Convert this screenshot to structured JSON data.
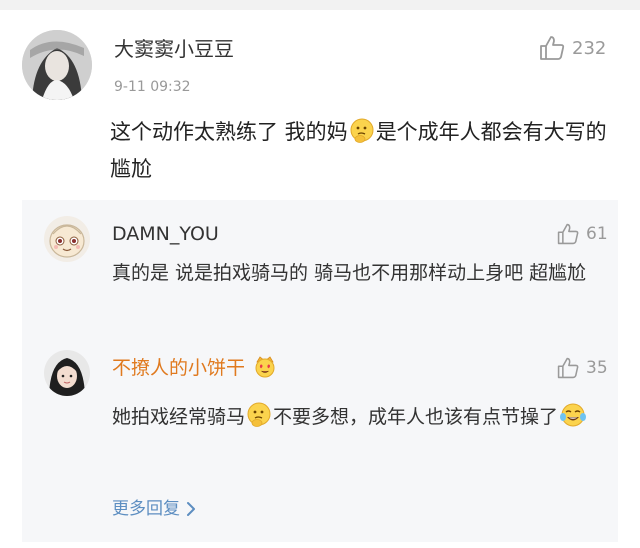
{
  "colors": {
    "username": "#333333",
    "reply_username_blue": "#333333",
    "reply_username_orange": "#e07a1f",
    "link": "#5d8ec1",
    "muted": "#999999",
    "panel_bg": "#f6f7f9"
  },
  "main_comment": {
    "username": "大窦窦小豆豆",
    "time": "9-11 09:32",
    "likes": "232",
    "text_part1": "这个动作太熟练了 我的妈",
    "text_part2": "是个成年人都会有大写的尴尬",
    "emoji": "thinking-face-icon"
  },
  "replies": [
    {
      "username": "DAMN_YOU",
      "likes": "61",
      "text": "真的是 说是拍戏骑马的 骑马也不用那样动上身吧 超尴尬",
      "avatar": "cartoon-baby-icon"
    },
    {
      "username": "不撩人的小饼干",
      "likes": "35",
      "badge": "heart-eyes-crown-icon",
      "text_part1": "她拍戏经常骑马",
      "text_part2": "不要多想，成年人也该有点节操了",
      "emoji1": "thinking-face-icon",
      "emoji2": "tears-of-joy-icon",
      "avatar": "girl-avatar-icon"
    }
  ],
  "more_replies_label": "更多回复"
}
